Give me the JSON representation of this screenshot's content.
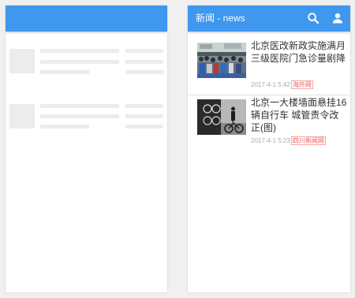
{
  "app": {
    "title": "新闻 - news",
    "accent_color": "#3f97ee",
    "actions": [
      {
        "name": "search",
        "icon": "search-icon"
      },
      {
        "name": "account",
        "icon": "account-icon"
      }
    ]
  },
  "loading_screen": {
    "state": "skeleton-placeholder",
    "placeholder_color": "#ececec"
  },
  "news": [
    {
      "title": "北京医改新政实施满月 三级医院门急诊量剧降",
      "time": "2017-4-1 5:42",
      "source": "海外网"
    },
    {
      "title": "北京一大楼墙面悬挂16辆自行车 城管责令改正(图)",
      "time": "2017-4-1 5:23",
      "source": "四川新闻网"
    }
  ]
}
